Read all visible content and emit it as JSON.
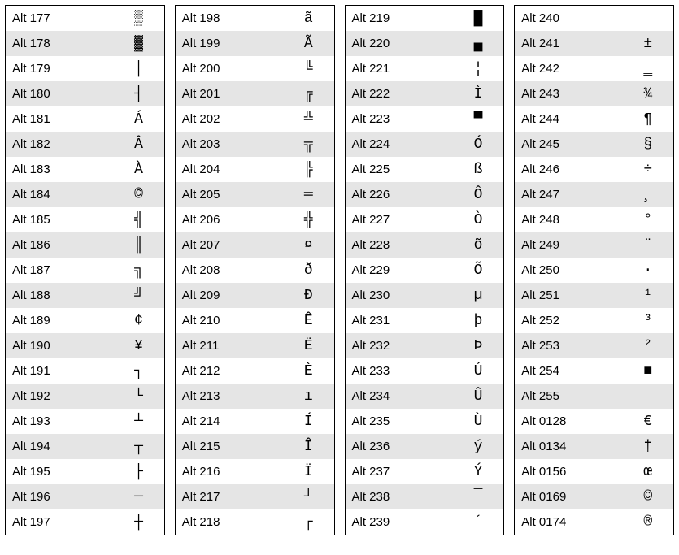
{
  "columns": [
    {
      "rows": [
        {
          "code": "Alt 177",
          "char": "▒"
        },
        {
          "code": "Alt 178",
          "char": "▓"
        },
        {
          "code": "Alt 179",
          "char": "│"
        },
        {
          "code": "Alt 180",
          "char": "┤"
        },
        {
          "code": "Alt 181",
          "char": "Á"
        },
        {
          "code": "Alt 182",
          "char": "Â"
        },
        {
          "code": "Alt 183",
          "char": "À"
        },
        {
          "code": "Alt 184",
          "char": "©"
        },
        {
          "code": "Alt 185",
          "char": "╣"
        },
        {
          "code": "Alt 186",
          "char": "║"
        },
        {
          "code": "Alt 187",
          "char": "╗"
        },
        {
          "code": "Alt 188",
          "char": "╝"
        },
        {
          "code": "Alt 189",
          "char": "¢"
        },
        {
          "code": "Alt 190",
          "char": "¥"
        },
        {
          "code": "Alt 191",
          "char": "┐"
        },
        {
          "code": "Alt 192",
          "char": "└"
        },
        {
          "code": "Alt 193",
          "char": "┴"
        },
        {
          "code": "Alt 194",
          "char": "┬"
        },
        {
          "code": "Alt 195",
          "char": "├"
        },
        {
          "code": "Alt 196",
          "char": "─"
        },
        {
          "code": "Alt 197",
          "char": "┼"
        }
      ]
    },
    {
      "rows": [
        {
          "code": "Alt 198",
          "char": "ã"
        },
        {
          "code": "Alt 199",
          "char": "Ã"
        },
        {
          "code": "Alt 200",
          "char": "╚"
        },
        {
          "code": "Alt 201",
          "char": "╔"
        },
        {
          "code": "Alt 202",
          "char": "╩"
        },
        {
          "code": "Alt 203",
          "char": "╦"
        },
        {
          "code": "Alt 204",
          "char": "╠"
        },
        {
          "code": "Alt 205",
          "char": "═"
        },
        {
          "code": "Alt 206",
          "char": "╬"
        },
        {
          "code": "Alt 207",
          "char": "¤"
        },
        {
          "code": "Alt 208",
          "char": "ð"
        },
        {
          "code": "Alt 209",
          "char": "Ð"
        },
        {
          "code": "Alt 210",
          "char": "Ê"
        },
        {
          "code": "Alt 211",
          "char": "Ë"
        },
        {
          "code": "Alt 212",
          "char": "È"
        },
        {
          "code": "Alt 213",
          "char": "ı"
        },
        {
          "code": "Alt 214",
          "char": "Í"
        },
        {
          "code": "Alt 215",
          "char": "Î"
        },
        {
          "code": "Alt 216",
          "char": "Ï"
        },
        {
          "code": "Alt 217",
          "char": "┘"
        },
        {
          "code": "Alt 218",
          "char": "┌"
        }
      ]
    },
    {
      "rows": [
        {
          "code": "Alt 219",
          "char": "█"
        },
        {
          "code": "Alt 220",
          "char": "▄"
        },
        {
          "code": "Alt 221",
          "char": "¦"
        },
        {
          "code": "Alt 222",
          "char": "Ì"
        },
        {
          "code": "Alt 223",
          "char": "▀"
        },
        {
          "code": "Alt 224",
          "char": "Ó"
        },
        {
          "code": "Alt 225",
          "char": "ß"
        },
        {
          "code": "Alt 226",
          "char": "Ô"
        },
        {
          "code": "Alt 227",
          "char": "Ò"
        },
        {
          "code": "Alt 228",
          "char": "õ"
        },
        {
          "code": "Alt 229",
          "char": "Õ"
        },
        {
          "code": "Alt 230",
          "char": "µ"
        },
        {
          "code": "Alt 231",
          "char": "þ"
        },
        {
          "code": "Alt 232",
          "char": "Þ"
        },
        {
          "code": "Alt 233",
          "char": "Ú"
        },
        {
          "code": "Alt 234",
          "char": "Û"
        },
        {
          "code": "Alt 235",
          "char": "Ù"
        },
        {
          "code": "Alt 236",
          "char": "ý"
        },
        {
          "code": "Alt 237",
          "char": "Ý"
        },
        {
          "code": "Alt 238",
          "char": "¯"
        },
        {
          "code": "Alt 239",
          "char": "´"
        }
      ]
    },
    {
      "rows": [
        {
          "code": "Alt 240",
          "char": "­"
        },
        {
          "code": "Alt 241",
          "char": "±"
        },
        {
          "code": "Alt 242",
          "char": "‗"
        },
        {
          "code": "Alt 243",
          "char": "¾"
        },
        {
          "code": "Alt 244",
          "char": "¶"
        },
        {
          "code": "Alt 245",
          "char": "§"
        },
        {
          "code": "Alt 246",
          "char": "÷"
        },
        {
          "code": "Alt 247",
          "char": "¸"
        },
        {
          "code": "Alt 248",
          "char": "°"
        },
        {
          "code": "Alt 249",
          "char": "¨"
        },
        {
          "code": "Alt 250",
          "char": "·"
        },
        {
          "code": "Alt 251",
          "char": "¹"
        },
        {
          "code": "Alt 252",
          "char": "³"
        },
        {
          "code": "Alt 253",
          "char": "²"
        },
        {
          "code": "Alt 254",
          "char": "■"
        },
        {
          "code": "Alt 255",
          "char": " "
        },
        {
          "code": "Alt 0128",
          "char": "€"
        },
        {
          "code": "Alt 0134",
          "char": "†"
        },
        {
          "code": "Alt 0156",
          "char": "œ"
        },
        {
          "code": "Alt 0169",
          "char": "©"
        },
        {
          "code": "Alt 0174",
          "char": "®"
        }
      ]
    }
  ]
}
